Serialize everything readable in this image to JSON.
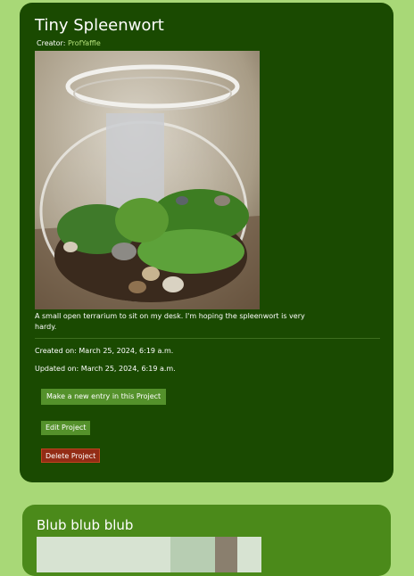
{
  "project": {
    "title": "Tiny Spleenwort",
    "creator_label": "Creator:",
    "creator_name": "ProfYaffle",
    "description": "A small open terrarium to sit on my desk. I'm hoping the spleenwort is very hardy.",
    "created": "Created on: March 25, 2024, 6:19 a.m.",
    "updated": "Updated on: March 25, 2024, 6:19 a.m.",
    "new_entry_label": "Make a new entry in this Project",
    "edit_label": "Edit Project",
    "delete_label": "Delete Project"
  },
  "next_project": {
    "title": "Blub blub blub"
  },
  "colors": {
    "page_bg": "#a8d877",
    "card_bg": "#1a4a01",
    "card2_bg": "#4b8a1a",
    "link": "#b3e07a",
    "btn_green": "#54912b",
    "btn_red": "#932c15"
  }
}
